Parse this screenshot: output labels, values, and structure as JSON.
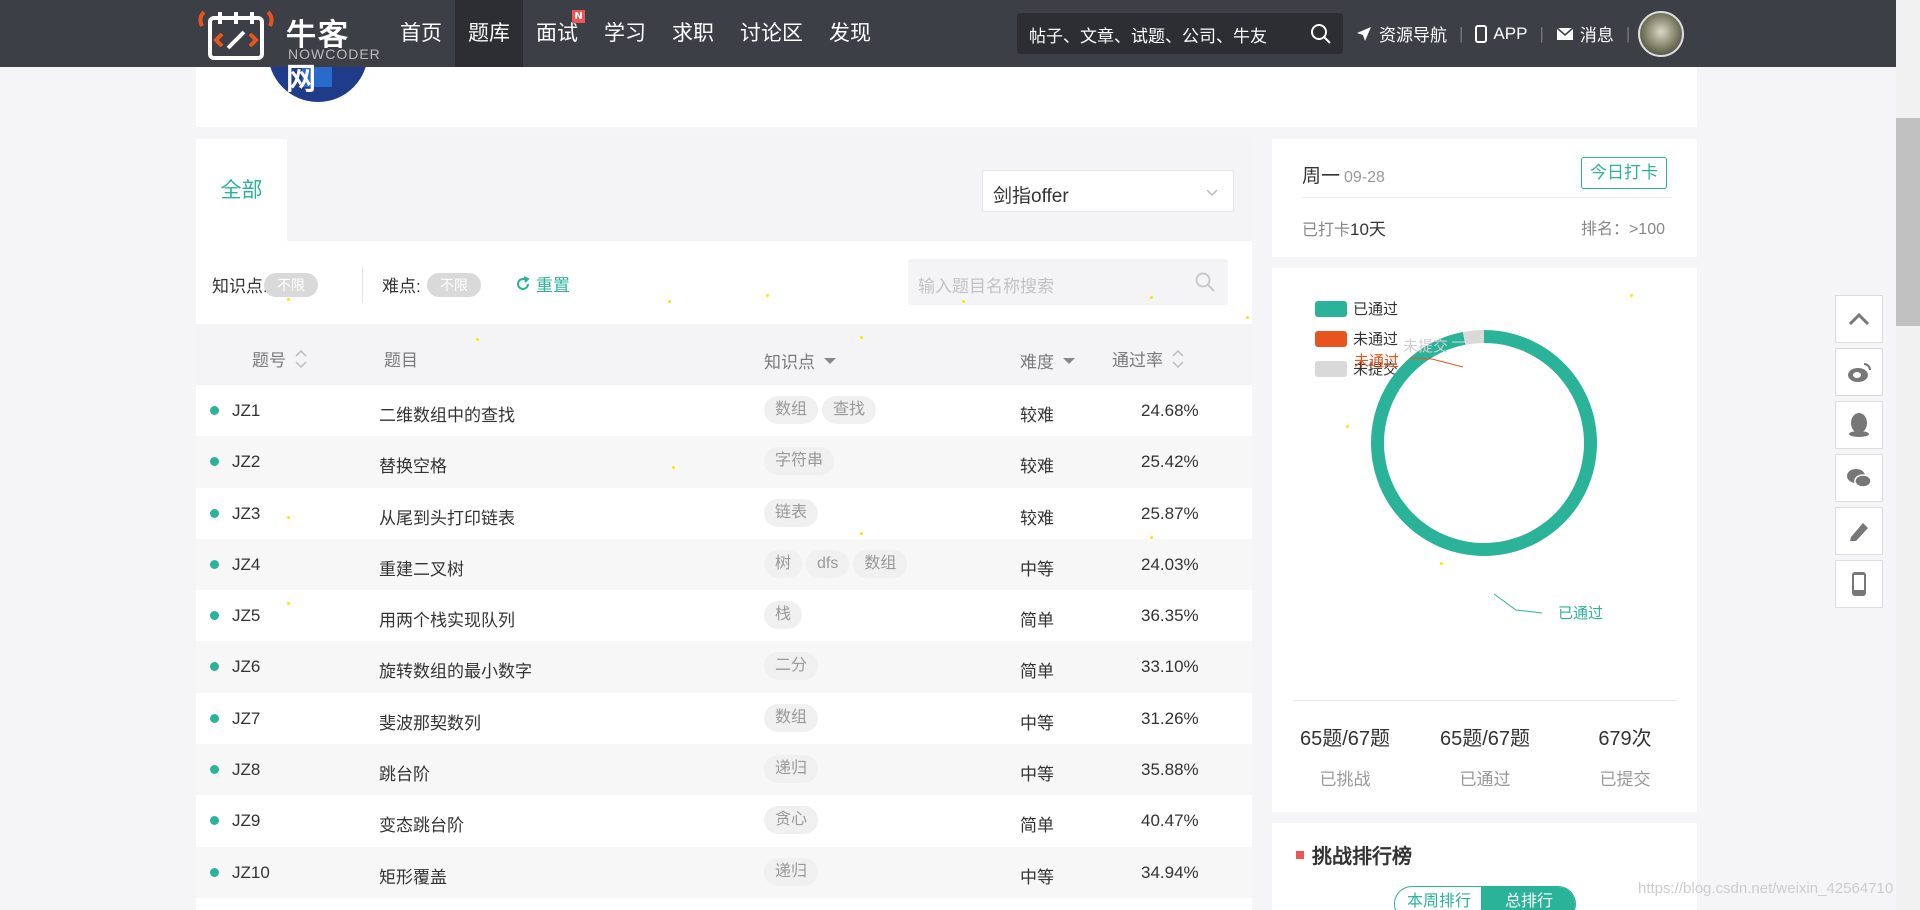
{
  "brand": {
    "name_cn": "牛客网",
    "name_en": "NOWCODER"
  },
  "nav": {
    "items": [
      {
        "label": "首页",
        "active": false
      },
      {
        "label": "题库",
        "active": true
      },
      {
        "label": "面试",
        "active": false,
        "badge": "N"
      },
      {
        "label": "学习",
        "active": false
      },
      {
        "label": "求职",
        "active": false
      },
      {
        "label": "讨论区",
        "active": false
      },
      {
        "label": "发现",
        "active": false
      }
    ],
    "search_placeholder": "帖子、文章、试题、公司、牛友",
    "links": {
      "resources": "资源导航",
      "app": "APP",
      "messages": "消息"
    }
  },
  "tabs": {
    "all": "全部"
  },
  "collection": {
    "selected": "剑指offer"
  },
  "filters": {
    "knowledge_label": "知识点:",
    "knowledge_value": "不限",
    "difficulty_label": "难点:",
    "difficulty_value": "不限",
    "reset": "重置",
    "search_placeholder": "输入题目名称搜索"
  },
  "table": {
    "headers": {
      "no": "题号",
      "title": "题目",
      "tags": "知识点",
      "difficulty": "难度",
      "rate": "通过率"
    },
    "rows": [
      {
        "no": "JZ1",
        "title": "二维数组中的查找",
        "tags": [
          "数组",
          "查找"
        ],
        "difficulty": "较难",
        "rate": "24.68%"
      },
      {
        "no": "JZ2",
        "title": "替换空格",
        "tags": [
          "字符串"
        ],
        "difficulty": "较难",
        "rate": "25.42%"
      },
      {
        "no": "JZ3",
        "title": "从尾到头打印链表",
        "tags": [
          "链表"
        ],
        "difficulty": "较难",
        "rate": "25.87%"
      },
      {
        "no": "JZ4",
        "title": "重建二叉树",
        "tags": [
          "树",
          "dfs",
          "数组"
        ],
        "difficulty": "中等",
        "rate": "24.03%"
      },
      {
        "no": "JZ5",
        "title": "用两个栈实现队列",
        "tags": [
          "栈"
        ],
        "difficulty": "简单",
        "rate": "36.35%"
      },
      {
        "no": "JZ6",
        "title": "旋转数组的最小数字",
        "tags": [
          "二分"
        ],
        "difficulty": "简单",
        "rate": "33.10%"
      },
      {
        "no": "JZ7",
        "title": "斐波那契数列",
        "tags": [
          "数组"
        ],
        "difficulty": "中等",
        "rate": "31.26%"
      },
      {
        "no": "JZ8",
        "title": "跳台阶",
        "tags": [
          "递归"
        ],
        "difficulty": "中等",
        "rate": "35.88%"
      },
      {
        "no": "JZ9",
        "title": "变态跳台阶",
        "tags": [
          "贪心"
        ],
        "difficulty": "简单",
        "rate": "40.47%"
      },
      {
        "no": "JZ10",
        "title": "矩形覆盖",
        "tags": [
          "递归"
        ],
        "difficulty": "中等",
        "rate": "34.94%"
      }
    ]
  },
  "checkin": {
    "weekday": "周一",
    "date": "09-28",
    "button": "今日打卡",
    "streak_prefix": "已打卡",
    "streak_days": "10天",
    "rank": "排名：>100"
  },
  "progress_chart": {
    "type": "pie",
    "legend": [
      {
        "label": "已通过",
        "color": "#2bb39a"
      },
      {
        "label": "未通过",
        "color": "#e8541e"
      },
      {
        "label": "未提交",
        "color": "#d9d9d9"
      }
    ],
    "callouts": {
      "passed": "已通过",
      "failed": "未通过",
      "unsubmitted": "未提交"
    },
    "values": {
      "passed": 65,
      "failed": 0,
      "unsubmitted": 2
    }
  },
  "stats": [
    {
      "value": "65题/67题",
      "label": "已挑战"
    },
    {
      "value": "65题/67题",
      "label": "已通过"
    },
    {
      "value": "679次",
      "label": "已提交"
    }
  ],
  "leaderboard": {
    "title": "挑战排行榜",
    "tab_week": "本周排行",
    "tab_total": "总排行"
  },
  "watermark": "https://blog.csdn.net/weixin_42564710"
}
